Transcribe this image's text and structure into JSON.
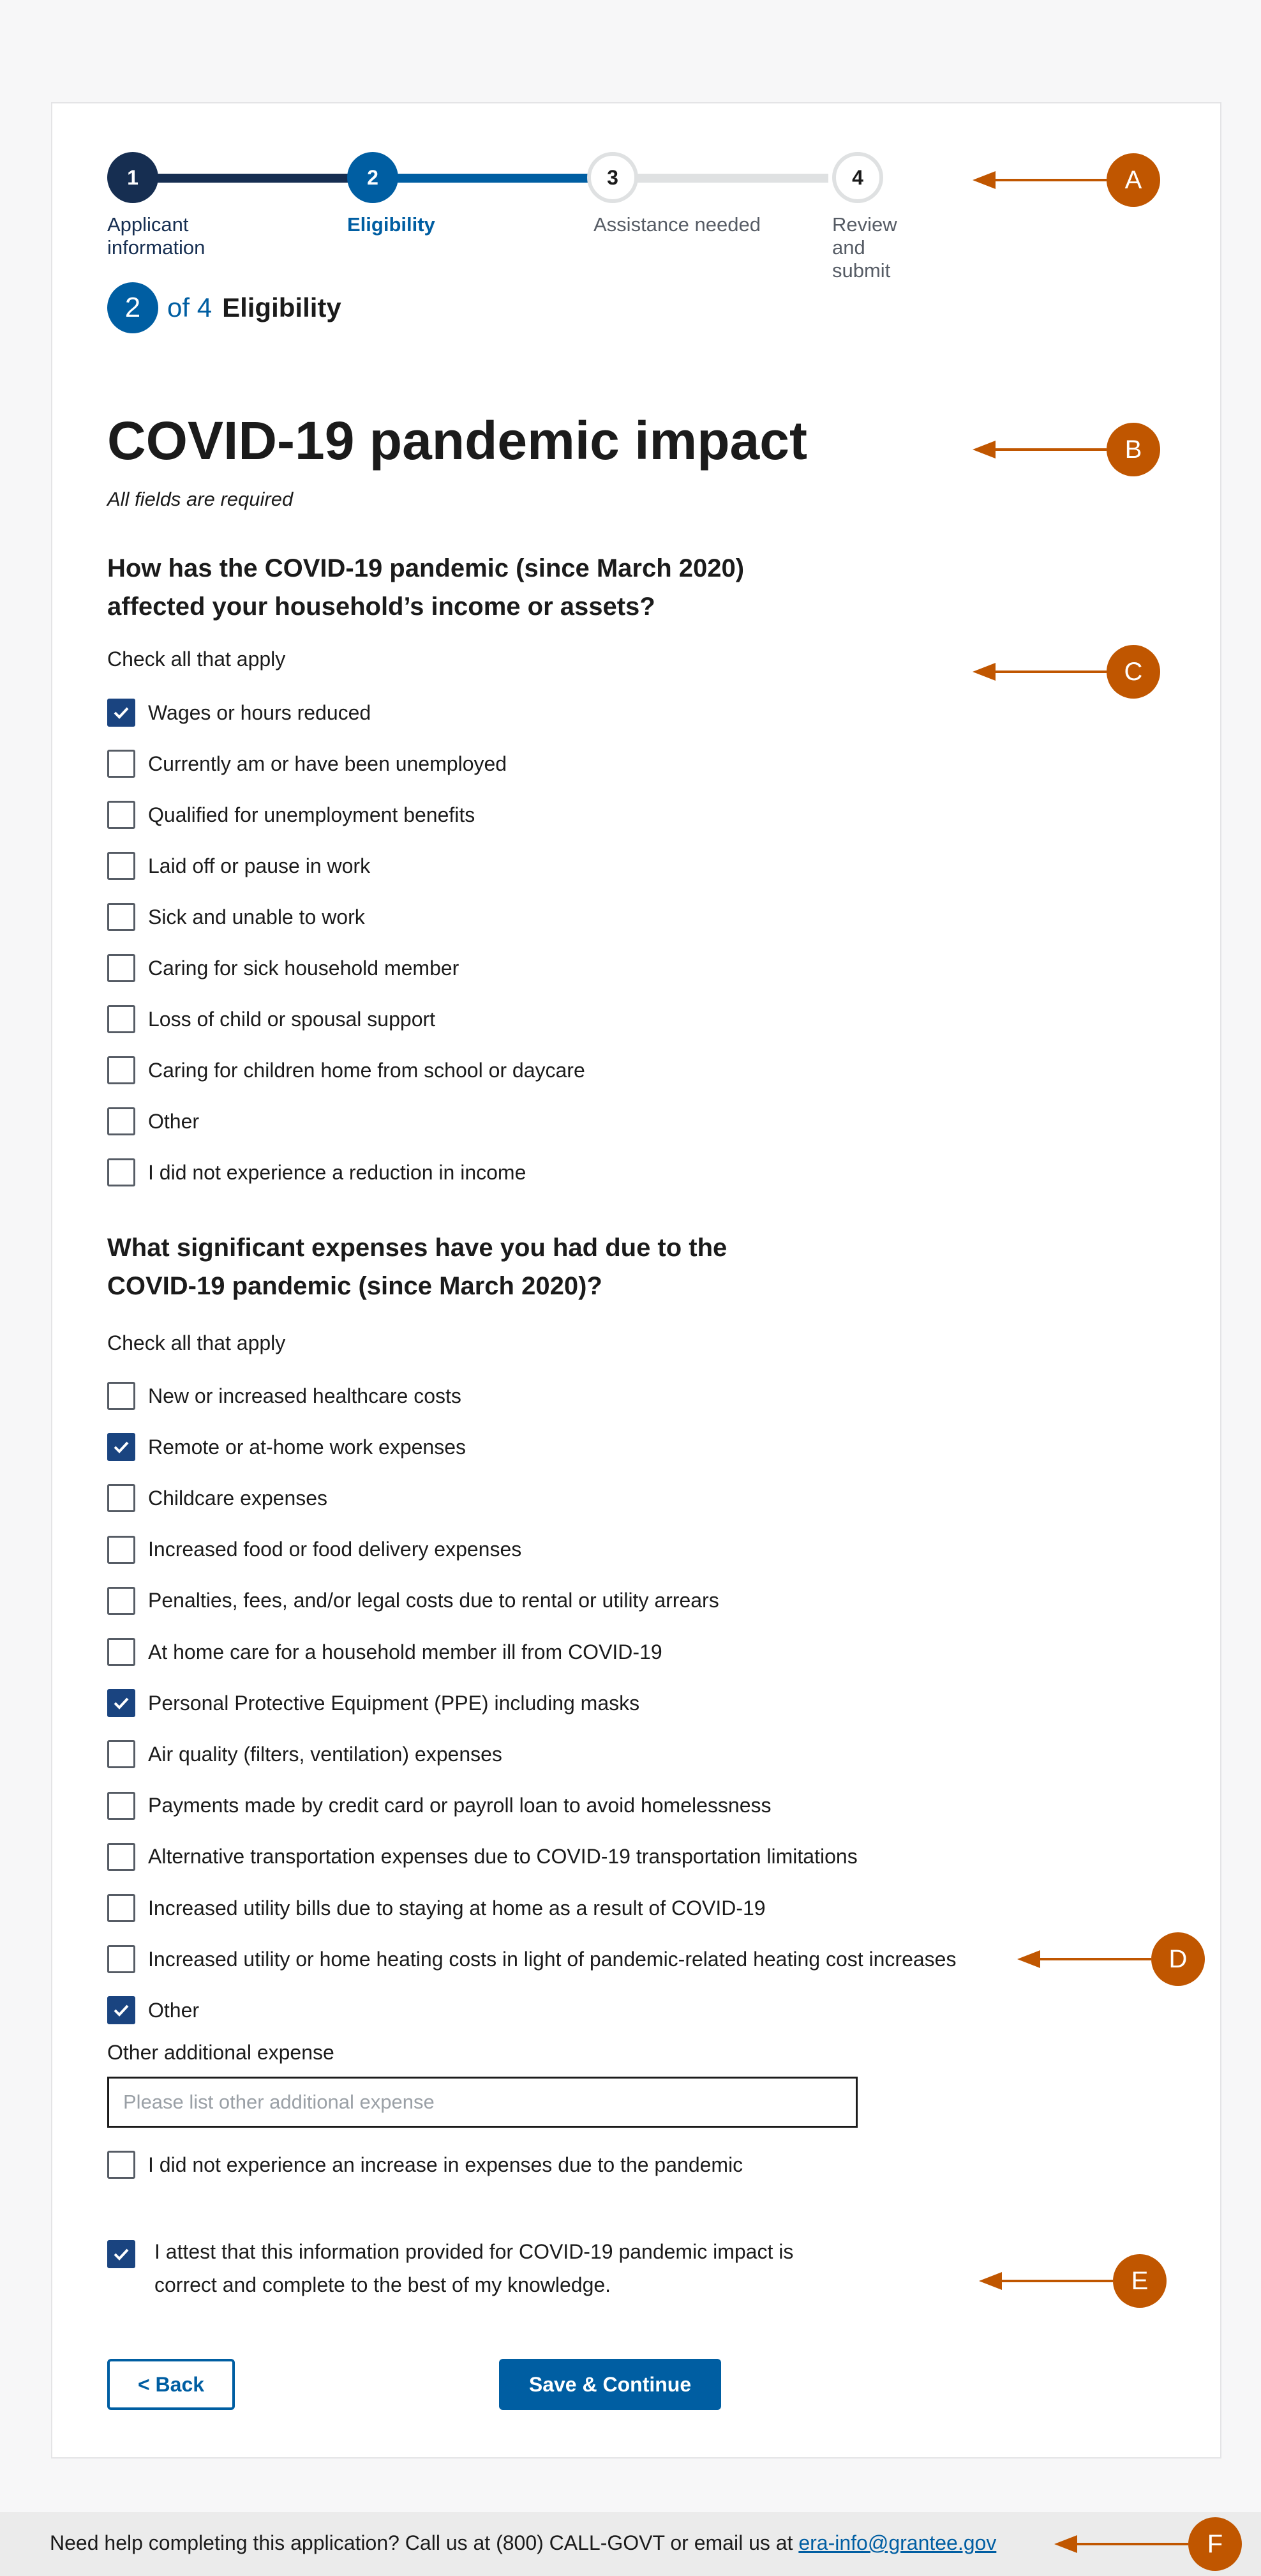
{
  "colors": {
    "primary": "#005ea2",
    "primary_dark": "#162e51",
    "checkbox_checked": "#1a4480",
    "annotation": "#c05600",
    "step_incomplete": "#dfe1e2"
  },
  "steps": [
    {
      "number": "1",
      "label": "Applicant information",
      "state": "complete"
    },
    {
      "number": "2",
      "label": "Eligibility",
      "state": "current"
    },
    {
      "number": "3",
      "label": "Assistance needed",
      "state": "incomplete"
    },
    {
      "number": "4",
      "label": "Review and submit",
      "state": "incomplete"
    }
  ],
  "step_counter": {
    "current": "2",
    "of_text": "of 4",
    "name": "Eligibility"
  },
  "page": {
    "title": "COVID-19 pandemic impact",
    "required_note": "All fields are required"
  },
  "income_question": {
    "heading": "How has the COVID-19 pandemic (since March 2020) affected your household’s income or assets?",
    "hint": "Check all that apply",
    "options": [
      {
        "label": "Wages or hours reduced",
        "checked": true
      },
      {
        "label": "Currently am or have been unemployed",
        "checked": false
      },
      {
        "label": "Qualified for unemployment benefits",
        "checked": false
      },
      {
        "label": "Laid off or pause in work",
        "checked": false
      },
      {
        "label": "Sick and unable to work",
        "checked": false
      },
      {
        "label": "Caring for sick household member",
        "checked": false
      },
      {
        "label": "Loss of child or spousal support",
        "checked": false
      },
      {
        "label": "Caring for children home from school or daycare",
        "checked": false
      },
      {
        "label": "Other",
        "checked": false
      },
      {
        "label": "I did not experience a reduction in income",
        "checked": false
      }
    ]
  },
  "expenses_question": {
    "heading": "What significant expenses have you had due to the COVID-19 pandemic (since March 2020)?",
    "hint": "Check all that apply",
    "options": [
      {
        "label": "New or increased healthcare costs",
        "checked": false
      },
      {
        "label": "Remote or at-home work expenses",
        "checked": true
      },
      {
        "label": "Childcare expenses",
        "checked": false
      },
      {
        "label": "Increased food or food delivery expenses",
        "checked": false
      },
      {
        "label": "Penalties, fees, and/or legal costs due to rental or utility arrears",
        "checked": false
      },
      {
        "label": "At home care for a household member ill from COVID-19",
        "checked": false
      },
      {
        "label": "Personal Protective Equipment (PPE) including masks",
        "checked": true
      },
      {
        "label": "Air quality (filters, ventilation) expenses",
        "checked": false
      },
      {
        "label": "Payments made by credit card or payroll loan to avoid homelessness",
        "checked": false
      },
      {
        "label": "Alternative transportation expenses due to COVID-19 transportation limitations",
        "checked": false
      },
      {
        "label": "Increased utility bills due to staying at home as a result of COVID-19",
        "checked": false
      },
      {
        "label": "Increased utility or home heating costs in light of pandemic-related heating cost increases",
        "checked": false
      },
      {
        "label": "Other",
        "checked": true
      }
    ],
    "other_field": {
      "label": "Other additional expense",
      "placeholder": "Please list other additional expense",
      "value": ""
    },
    "none_option": {
      "label": "I did not experience an increase in expenses due to the pandemic",
      "checked": false
    }
  },
  "attestation": {
    "checked": true,
    "line1": "I attest that this information provided for COVID-19 pandemic impact is",
    "line2": "correct and complete to the best of my knowledge."
  },
  "buttons": {
    "back": "< Back",
    "save": "Save & Continue"
  },
  "footer": {
    "text": "Need help completing this application? Call us at (800) CALL-GOVT or email us at ",
    "email": "era-info@grantee.gov"
  },
  "annotations": [
    "A",
    "B",
    "C",
    "D",
    "E",
    "F"
  ]
}
